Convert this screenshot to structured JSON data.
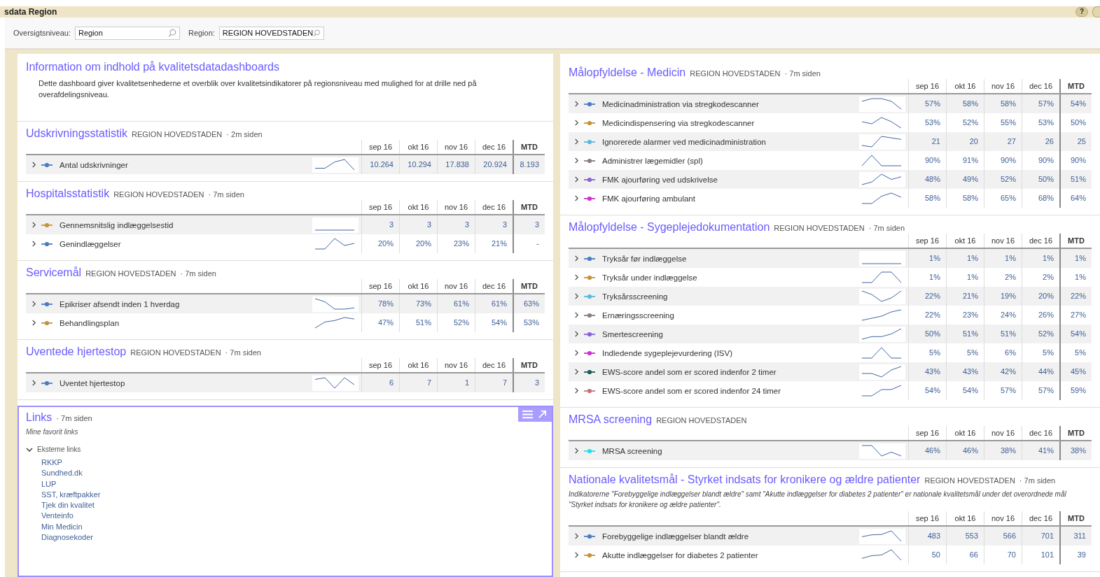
{
  "window": {
    "title": "sdata Region"
  },
  "help_button": {
    "label": "?"
  },
  "filters": [
    {
      "label": "Oversigtsniveau:",
      "value": "Region"
    },
    {
      "label": "Region:",
      "value": "REGION HOVEDSTADEN"
    }
  ],
  "left_column": {
    "info": {
      "title": "Information om indhold på kvalitetsdatadashboards",
      "text": "Dette dashboard giver kvalitetsenhederne et overblik over kvalitetsindikatorer på regionsniveau med mulighed for at drille ned på overafdelingsniveau."
    },
    "sections": [
      {
        "title": "Udskrivningsstatistik",
        "region": "REGION HOVEDSTADEN",
        "age": "· 2m siden",
        "columns": [
          "sep 16",
          "okt 16",
          "nov 16",
          "dec 16",
          "MTD"
        ],
        "rows": [
          {
            "label": "Antal udskrivninger",
            "color": "#4a7cc4",
            "values": [
              "10.264",
              "10.294",
              "17.838",
              "20.924",
              "8.193"
            ]
          }
        ]
      },
      {
        "title": "Hospitalsstatistik",
        "region": "REGION HOVEDSTADEN",
        "age": "· 7m siden",
        "columns": [
          "sep 16",
          "okt 16",
          "nov 16",
          "dec 16",
          "MTD"
        ],
        "rows": [
          {
            "label": "Gennemsnitslig indlæggelsestid",
            "color": "#c8913c",
            "values": [
              "3",
              "3",
              "3",
              "3",
              "3"
            ]
          },
          {
            "label": "Genindlæggelser",
            "color": "#4a7cc4",
            "values": [
              "20%",
              "20%",
              "23%",
              "21%",
              "-"
            ]
          }
        ]
      },
      {
        "title": "Servicemål",
        "region": "REGION HOVEDSTADEN",
        "age": "· 7m siden",
        "columns": [
          "sep 16",
          "okt 16",
          "nov 16",
          "dec 16",
          "MTD"
        ],
        "rows": [
          {
            "label": "Epikriser afsendt inden 1 hverdag",
            "color": "#4a7cc4",
            "values": [
              "78%",
              "73%",
              "61%",
              "61%",
              "63%"
            ]
          },
          {
            "label": "Behandlingsplan",
            "color": "#c8913c",
            "values": [
              "47%",
              "51%",
              "52%",
              "54%",
              "53%"
            ]
          }
        ]
      },
      {
        "title": "Uventede hjertestop",
        "region": "REGION HOVEDSTADEN",
        "age": "· 7m siden",
        "columns": [
          "sep 16",
          "okt 16",
          "nov 16",
          "dec 16",
          "MTD"
        ],
        "rows": [
          {
            "label": "Uventet hjertestop",
            "color": "#4a7cc4",
            "values": [
              "6",
              "7",
              "1",
              "7",
              "3"
            ]
          }
        ]
      }
    ],
    "links": {
      "title": "Links",
      "age": "· 7m siden",
      "subtitle": "Mine favorit links",
      "groups": [
        {
          "label": "Eksterne links",
          "expanded": true,
          "links": [
            "RKKP",
            "Sundhed.dk",
            "LUP",
            "SST, kræftpakker",
            "Tjek din kvalitet",
            "Venteinfo",
            "Min Medicin",
            "Diagnosekoder"
          ]
        }
      ]
    }
  },
  "right_column": {
    "sections": [
      {
        "title": "Målopfyldelse - Medicin",
        "region": "REGION HOVEDSTADEN",
        "age": "· 7m siden",
        "columns": [
          "sep 16",
          "okt 16",
          "nov 16",
          "dec 16",
          "MTD"
        ],
        "rows": [
          {
            "label": "Medicinadministration via stregkodescanner",
            "color": "#4a7cc4",
            "values": [
              "57%",
              "58%",
              "58%",
              "57%",
              "54%"
            ]
          },
          {
            "label": "Medicindispensering via stregkodescanner",
            "color": "#c8913c",
            "values": [
              "53%",
              "52%",
              "55%",
              "53%",
              "50%"
            ]
          },
          {
            "label": "Ignorerede alarmer ved medicinadministration",
            "color": "#5bb8e0",
            "values": [
              "21",
              "20",
              "27",
              "26",
              "25"
            ]
          },
          {
            "label": "Administrer lægemidler (spl)",
            "color": "#8a7f78",
            "values": [
              "90%",
              "91%",
              "90%",
              "90%",
              "90%"
            ]
          },
          {
            "label": "FMK ajourføring ved udskrivelse",
            "color": "#8a62d6",
            "values": [
              "48%",
              "49%",
              "52%",
              "50%",
              "51%"
            ]
          },
          {
            "label": "FMK ajourføring ambulant",
            "color": "#cc33cc",
            "values": [
              "58%",
              "58%",
              "65%",
              "68%",
              "64%"
            ]
          }
        ]
      },
      {
        "title": "Målopfyldelse - Sygeplejedokumentation",
        "region": "REGION HOVEDSTADEN",
        "age": "· 7m siden",
        "columns": [
          "sep 16",
          "okt 16",
          "nov 16",
          "dec 16",
          "MTD"
        ],
        "rows": [
          {
            "label": "Tryksår før indlæggelse",
            "color": "#4a7cc4",
            "values": [
              "1%",
              "1%",
              "1%",
              "1%",
              "1%"
            ]
          },
          {
            "label": "Tryksår under indlæggelse",
            "color": "#c8913c",
            "values": [
              "1%",
              "1%",
              "2%",
              "2%",
              "1%"
            ]
          },
          {
            "label": "Tryksårsscreening",
            "color": "#5bb8e0",
            "values": [
              "22%",
              "21%",
              "19%",
              "20%",
              "22%"
            ]
          },
          {
            "label": "Ernæringsscreening",
            "color": "#8a7f78",
            "values": [
              "22%",
              "23%",
              "24%",
              "26%",
              "27%"
            ]
          },
          {
            "label": "Smertescreening",
            "color": "#8a62d6",
            "values": [
              "50%",
              "51%",
              "51%",
              "52%",
              "54%"
            ]
          },
          {
            "label": "Indledende sygeplejevurdering (ISV)",
            "color": "#cc33cc",
            "values": [
              "5%",
              "5%",
              "6%",
              "5%",
              "5%"
            ]
          },
          {
            "label": "EWS-score andel som er scored indenfor 2 timer",
            "color": "#1f5c5c",
            "values": [
              "43%",
              "43%",
              "42%",
              "44%",
              "45%"
            ]
          },
          {
            "label": "EWS-score andel som er scored indenfor 24 timer",
            "color": "#c87080",
            "values": [
              "54%",
              "54%",
              "57%",
              "57%",
              "59%"
            ]
          }
        ]
      },
      {
        "title": "MRSA screening",
        "region": "REGION HOVEDSTADEN",
        "columns": [
          "sep 16",
          "okt 16",
          "nov 16",
          "dec 16",
          "MTD"
        ],
        "rows": [
          {
            "label": "MRSA screening",
            "color": "#22e0ee",
            "values": [
              "46%",
              "46%",
              "38%",
              "41%",
              "38%"
            ]
          }
        ]
      },
      {
        "title": "Nationale kvalitetsmål - Styrket indsats for kronikere og ældre patienter",
        "region": "REGION HOVEDSTADEN",
        "age": "· 7m siden",
        "description": "Indikatorerne \"Forebyggelige indlæggelser blandt ældre\" samt \"Akutte indlæggelser for diabetes 2 patienter\" er nationale kvalitetsmål under det overordnede mål \"Styrket indsats for kronikere og ældre patienter\".",
        "columns": [
          "sep 16",
          "okt 16",
          "nov 16",
          "dec 16",
          "MTD"
        ],
        "rows": [
          {
            "label": "Forebyggelige indlæggelser blandt ældre",
            "color": "#4a7cc4",
            "values": [
              "483",
              "553",
              "566",
              "701",
              "311"
            ]
          },
          {
            "label": "Akutte indlæggelser for diabetes 2 patienter",
            "color": "#c8913c",
            "values": [
              "50",
              "66",
              "70",
              "101",
              "39"
            ]
          }
        ]
      }
    ]
  }
}
